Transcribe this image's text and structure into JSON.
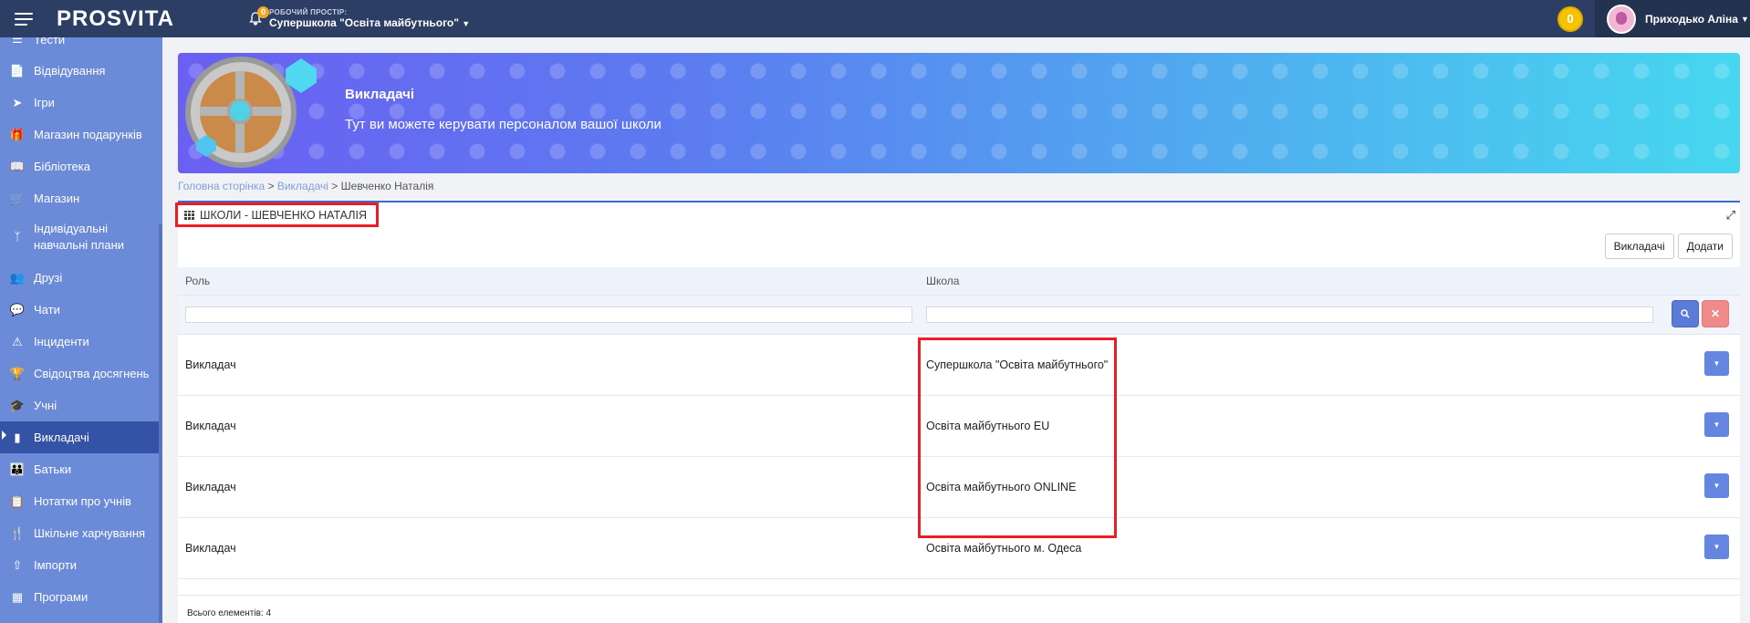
{
  "topbar": {
    "logo": "PROSVITA",
    "notifications_count": "0",
    "workspace_label": "РОБОЧИЙ ПРОСТІР:",
    "workspace_name": "Супершкола \"Освіта майбутнього\"",
    "coins": "0",
    "user_name": "Приходько Аліна"
  },
  "sidebar": {
    "items": [
      {
        "label": "Тести",
        "icon": "list-icon"
      },
      {
        "label": "Відвідування",
        "icon": "document-icon"
      },
      {
        "label": "Ігри",
        "icon": "rocket-icon"
      },
      {
        "label": "Магазин подарунків",
        "icon": "gift-icon"
      },
      {
        "label": "Бібліотека",
        "icon": "book-icon"
      },
      {
        "label": "Магазин",
        "icon": "cart-icon"
      },
      {
        "label": "Індивідуальні навчальні плани",
        "icon": "branch-icon"
      },
      {
        "label": "Друзі",
        "icon": "users-icon"
      },
      {
        "label": "Чати",
        "icon": "chat-icon"
      },
      {
        "label": "Інциденти",
        "icon": "warning-icon"
      },
      {
        "label": "Свідоцтва досягнень",
        "icon": "trophy-icon"
      },
      {
        "label": "Учні",
        "icon": "graduation-cap-icon"
      },
      {
        "label": "Викладачі",
        "icon": "id-badge-icon",
        "active": true
      },
      {
        "label": "Батьки",
        "icon": "parents-icon"
      },
      {
        "label": "Нотатки про учнів",
        "icon": "notes-icon"
      },
      {
        "label": "Шкільне харчування",
        "icon": "cutlery-icon"
      },
      {
        "label": "Імпорти",
        "icon": "upload-icon"
      },
      {
        "label": "Програми",
        "icon": "program-icon"
      }
    ]
  },
  "banner": {
    "title": "Викладачі",
    "subtitle": "Тут ви можете керувати персоналом вашої школи"
  },
  "breadcrumb": {
    "home": "Головна сторінка",
    "section": "Викладачі",
    "sep": ">",
    "current": "Шевченко Наталія"
  },
  "panel": {
    "title": "ШКОЛИ - ШЕВЧЕНКО НАТАЛІЯ",
    "buttons": {
      "teachers": "Викладачі",
      "add": "Додати"
    },
    "columns": {
      "role": "Роль",
      "school": "Школа"
    },
    "rows": [
      {
        "role": "Викладач",
        "school": "Супершкола \"Освіта майбутнього\""
      },
      {
        "role": "Викладач",
        "school": "Освіта майбутнього EU"
      },
      {
        "role": "Викладач",
        "school": "Освіта майбутнього ONLINE"
      },
      {
        "role": "Викладач",
        "school": "Освіта майбутнього м. Одеса"
      }
    ],
    "footer": "Всього елементів: 4"
  },
  "colors": {
    "topbar": "#2c3e63",
    "sidebar": "#6b8ad7",
    "sidebar_active": "#3553a6",
    "accent": "#5b7bd8",
    "highlight": "#ee1c25"
  }
}
